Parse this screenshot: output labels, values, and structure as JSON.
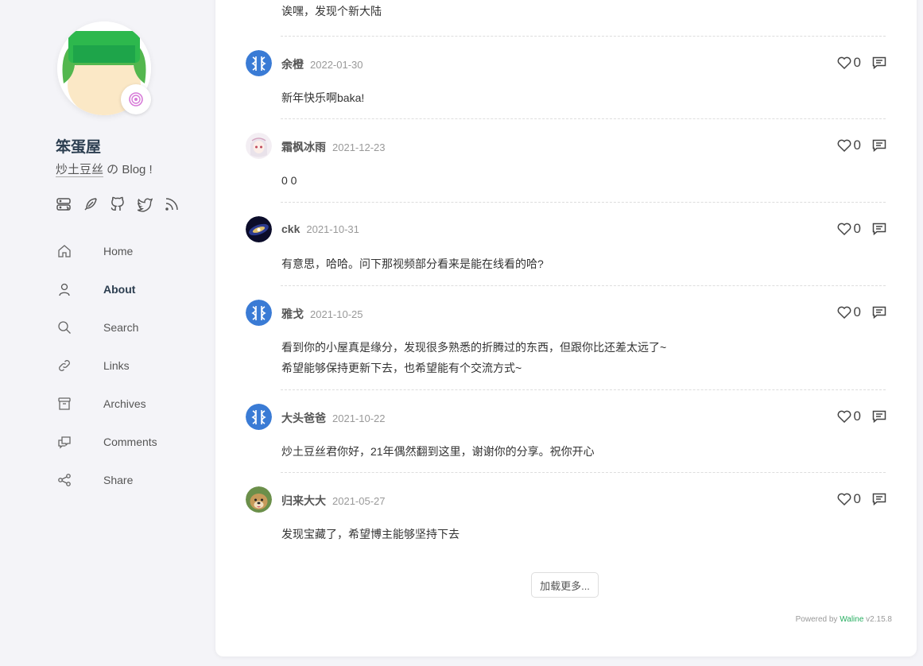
{
  "sidebar": {
    "title": "笨蛋屋",
    "desc_highlight": "炒土豆丝",
    "desc_rest": " の Blog !",
    "social_icons": [
      "server-icon",
      "feather-icon",
      "github-icon",
      "twitter-icon",
      "rss-icon"
    ],
    "nav": [
      {
        "label": "Home",
        "icon": "home-icon",
        "active": false
      },
      {
        "label": "About",
        "icon": "user-icon",
        "active": true
      },
      {
        "label": "Search",
        "icon": "search-icon",
        "active": false
      },
      {
        "label": "Links",
        "icon": "link-icon",
        "active": false
      },
      {
        "label": "Archives",
        "icon": "archive-icon",
        "active": false
      },
      {
        "label": "Comments",
        "icon": "comments-icon",
        "active": false
      },
      {
        "label": "Share",
        "icon": "share-icon",
        "active": false
      }
    ]
  },
  "main": {
    "top_text": "诶嘿，发现个新大陆",
    "comments": [
      {
        "author": "余橙",
        "date": "2022-01-30",
        "likes": "0",
        "body": [
          "新年快乐啊baka!"
        ],
        "avatar": "blue-logo"
      },
      {
        "author": "霜枫冰雨",
        "date": "2021-12-23",
        "likes": "0",
        "body": [
          "0 0"
        ],
        "avatar": "anime-girl"
      },
      {
        "author": "ckk",
        "date": "2021-10-31",
        "likes": "0",
        "body": [
          "有意思，哈哈。问下那视频部分看来是能在线看的哈?"
        ],
        "avatar": "galaxy"
      },
      {
        "author": "雅戈",
        "date": "2021-10-25",
        "likes": "0",
        "body": [
          "看到你的小屋真是缘分，发现很多熟悉的折腾过的东西，但跟你比还差太远了~",
          "希望能够保持更新下去，也希望能有个交流方式~"
        ],
        "avatar": "blue-logo"
      },
      {
        "author": "大头爸爸",
        "date": "2021-10-22",
        "likes": "0",
        "body": [
          "炒土豆丝君你好，21年偶然翻到这里，谢谢你的分享。祝你开心"
        ],
        "avatar": "blue-logo"
      },
      {
        "author": "归来大大",
        "date": "2021-05-27",
        "likes": "0",
        "body": [
          "发现宝藏了，希望博主能够坚持下去"
        ],
        "avatar": "dog"
      }
    ],
    "load_more": "加载更多...",
    "powered_prefix": "Powered by ",
    "powered_brand": "Waline",
    "powered_version": " v2.15.8"
  },
  "colors": {
    "accent": "#27ae60",
    "avatar_blue": "#3a7bd5",
    "hat_green": "#2db84d"
  }
}
